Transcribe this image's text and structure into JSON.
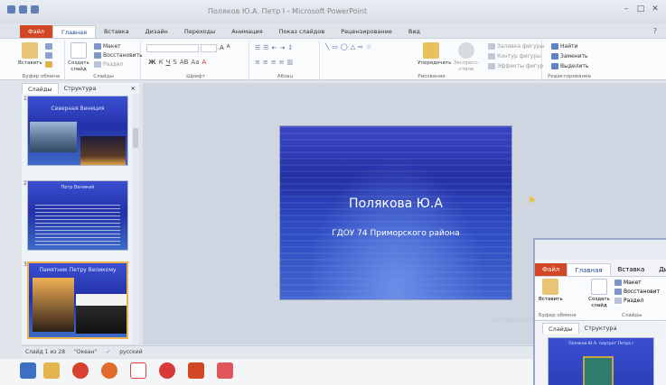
{
  "window": {
    "title": "Поляков Ю.А. Петр I - Microsoft PowerPoint",
    "help": "?"
  },
  "tabs": [
    {
      "label": "Файл"
    },
    {
      "label": "Главная"
    },
    {
      "label": "Вставка"
    },
    {
      "label": "Дизайн"
    },
    {
      "label": "Переходы"
    },
    {
      "label": "Анимация"
    },
    {
      "label": "Показ слайдов"
    },
    {
      "label": "Рецензирование"
    },
    {
      "label": "Вид"
    }
  ],
  "ribbon": {
    "paste": "Вставить",
    "create_slide": "Создать слайд",
    "layout": "Макет",
    "reset": "Восстановить",
    "section": "Раздел",
    "font_size_up": "A",
    "font_size_down": "A",
    "arrange": "Упорядочить",
    "quick_styles": "Экспресс-стили",
    "shape_fill": "Заливка фигуры",
    "shape_outline": "Контур фигуры",
    "shape_effects": "Эффекты фигур",
    "find": "Найти",
    "replace": "Заменить",
    "select": "Выделить",
    "groups": {
      "clipboard": "Буфер обмена",
      "slides": "Слайды",
      "font": "Шрифт",
      "paragraph": "Абзац",
      "drawing": "Рисование",
      "editing": "Редактирование"
    }
  },
  "pane": {
    "tab_slides": "Слайды",
    "tab_outline": "Структура",
    "close": "×",
    "thumbs": [
      {
        "num": "1",
        "title": "Северная Венеция"
      },
      {
        "num": "2",
        "title": "Петр Великий"
      },
      {
        "num": "3",
        "title": "Памятник Петру Великому"
      }
    ]
  },
  "slide": {
    "title": "Полякова Ю.А",
    "subtitle": "ГДОУ 74 Приморского района"
  },
  "status": {
    "slide_of": "Слайд 1 из 28",
    "theme": "\"Океан\"",
    "language": "русский"
  },
  "ghost_text": "Активация",
  "second_window": {
    "tab_file": "Файл",
    "tab_home": "Главная",
    "tab_insert": "Вставка",
    "tab_design": "Дизай",
    "layout": "Макет",
    "reset": "Восстановит",
    "section": "Раздел",
    "paste": "Вставить",
    "create_slide": "Создать слайд",
    "group_clipboard": "Буфер обмена",
    "group_slides": "Слайды",
    "pane_slides": "Слайды",
    "pane_outline": "Структура",
    "thumb_title": "Поляков Ю.А. портрет Петра I"
  },
  "colors": {
    "file_tab": "#d24726",
    "accent": "#1e4b8f",
    "slide_blue": "#2430a6"
  }
}
